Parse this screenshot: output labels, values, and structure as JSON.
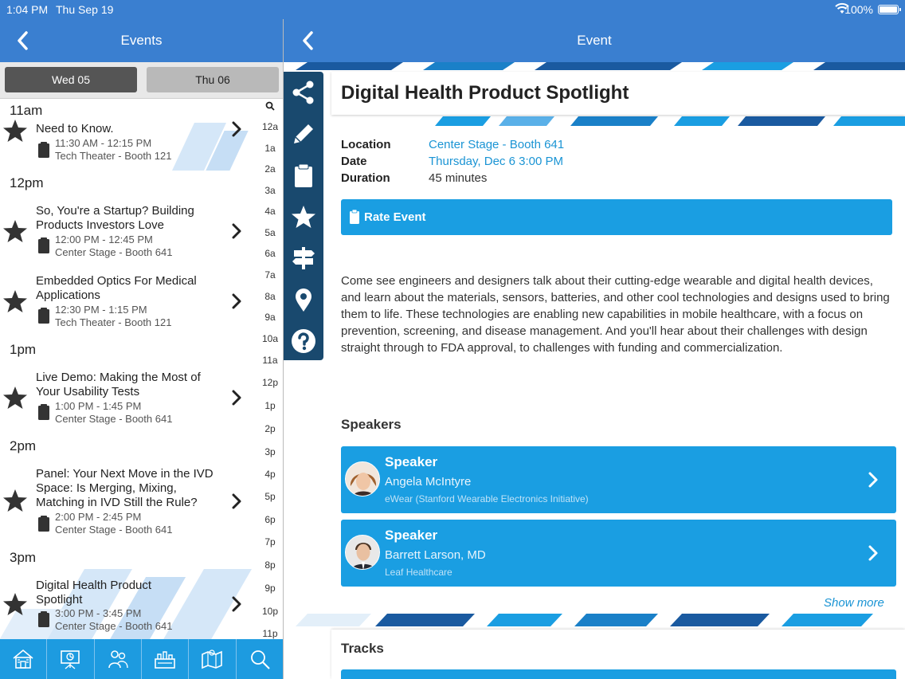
{
  "status": {
    "time": "1:04 PM",
    "date": "Thu Sep 19",
    "battery": "100%"
  },
  "left": {
    "nav_title": "Events",
    "dates": [
      {
        "label": "Wed 05",
        "selected": true
      },
      {
        "label": "Thu 06",
        "selected": false
      }
    ],
    "hour_labels": [
      "11am",
      "12pm",
      "1pm",
      "2pm",
      "3pm"
    ],
    "events": [
      {
        "title": "Need to Know.",
        "time": "11:30 AM - 12:15 PM",
        "location": "Tech Theater - Booth 121"
      },
      {
        "title": "So, You're a Startup? Building Products Investors Love",
        "time": "12:00 PM - 12:45 PM",
        "location": "Center Stage - Booth 641"
      },
      {
        "title": "Embedded Optics For Medical Applications",
        "time": "12:30 PM - 1:15 PM",
        "location": "Tech Theater - Booth 121"
      },
      {
        "title": "Live Demo: Making the Most of Your Usability Tests",
        "time": "1:00 PM - 1:45 PM",
        "location": "Center Stage - Booth 641"
      },
      {
        "title": "Panel: Your Next Move in the IVD Space: Is Merging, Mixing, Matching in IVD Still the Rule?",
        "time": "2:00 PM - 2:45 PM",
        "location": "Center Stage - Booth 641"
      },
      {
        "title": "Digital Health Product Spotlight",
        "time": "3:00 PM - 3:45 PM",
        "location": "Center Stage - Booth 641"
      }
    ],
    "hour_index": [
      "12a",
      "1a",
      "2a",
      "3a",
      "4a",
      "5a",
      "6a",
      "7a",
      "8a",
      "9a",
      "10a",
      "11a",
      "12p",
      "1p",
      "2p",
      "3p",
      "4p",
      "5p",
      "6p",
      "7p",
      "8p",
      "9p",
      "10p",
      "11p"
    ],
    "tabs": [
      "home-icon",
      "presentation-icon",
      "people-icon",
      "exhibitors-icon",
      "map-icon",
      "search-icon"
    ]
  },
  "right": {
    "nav_title": "Event",
    "title": "Digital Health Product Spotlight",
    "details": [
      {
        "label": "Location",
        "value": "Center Stage - Booth 641",
        "link": true
      },
      {
        "label": "Date",
        "value": "Thursday, Dec 6 3:00 PM",
        "link": true
      },
      {
        "label": "Duration",
        "value": "45 minutes",
        "link": false
      }
    ],
    "rate_label": "Rate Event",
    "description": "Come see engineers and designers talk about their cutting-edge wearable and digital health devices, and learn about the materials, sensors, batteries, and other cool technologies and designs used to bring them to life. These technologies are enabling new capabilities in mobile healthcare, with a focus on prevention, screening, and disease management. And you'll hear about their challenges with design straight through to FDA approval, to challenges with funding and commercialization.",
    "speakers_header": "Speakers",
    "speakers": [
      {
        "role": "Speaker",
        "name": "Angela McIntyre",
        "org": "eWear (Stanford Wearable Electronics Initiative)"
      },
      {
        "role": "Speaker",
        "name": "Barrett Larson, MD",
        "org": "Leaf Healthcare"
      }
    ],
    "show_more": "Show more",
    "tracks_header": "Tracks",
    "toolbar": [
      "share-icon",
      "edit-icon",
      "clipboard-icon",
      "star-icon",
      "signpost-icon",
      "location-pin-icon",
      "help-icon"
    ]
  },
  "colors": {
    "navbar": "#3a7fd0",
    "accent": "#1a9ee2",
    "toolbar": "#19496e",
    "tabbar": "#1d9be0"
  }
}
